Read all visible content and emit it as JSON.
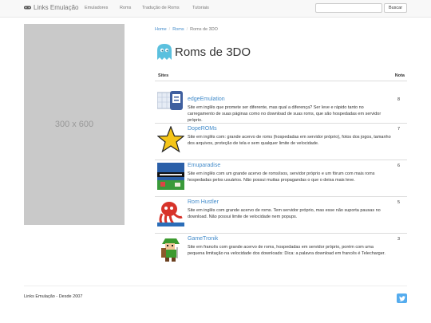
{
  "navbar": {
    "brand": "Links Emulação",
    "links": [
      "Emuladores",
      "Roms",
      "Tradução de Roms",
      "Tutoriais"
    ],
    "search_placeholder": "",
    "search_button": "Buscar"
  },
  "ad": {
    "label": "300 x 600"
  },
  "breadcrumb": {
    "home": "Home",
    "roms": "Roms",
    "current": "Roms de 3DO"
  },
  "page": {
    "title": "Roms de 3DO"
  },
  "table": {
    "headers": {
      "sites": "Sites",
      "score": "Nota"
    },
    "rows": [
      {
        "name": "edgeEmulation",
        "desc": "Site em inglês que promete ser diferente, mas qual a diferença? Ser leve e rápido tanto no carregamento de suas páginas como no download de suas roms, que são hospedadas em servidor próprio.",
        "score": "8",
        "icon": "robot-icon"
      },
      {
        "name": "DopeROMs",
        "desc": "Site em inglês com: grande acervo de roms (hospedadas em servidor próprio), fotos dos jogos, tamanho dos arquivos, proteção de tela e sem qualquer limite de velocidade.",
        "score": "7",
        "icon": "star-icon"
      },
      {
        "name": "Emuparadise",
        "desc": "Site em inglês com um grande acervo de roms/isos, servidor próprio e um fórum com mais roms hospedadas pelos usuários. Não possui muitas propagandas o que o deixa mais leve.",
        "score": "6",
        "icon": "emuparadise-icon"
      },
      {
        "name": "Rom Hustler",
        "desc": "Site em inglês com grande acervo de roms. Tem servidor próprio, mas esse não suporta pausas no download. Não possui limite de velocidade nem popups.",
        "score": "5",
        "icon": "octopus-icon"
      },
      {
        "name": "GameTronik",
        "desc": "Site em francês com grande acervo de roms, hospedadas em servidor próprio, porém com uma pequena limitação na velocidade dos downloads: Dica: a palavra download em francês é Telecharger.",
        "score": "3",
        "icon": "link-character-icon"
      }
    ]
  },
  "footer": {
    "text": "Links Emulação - Desde 2007"
  },
  "colors": {
    "accent": "#428bca",
    "twitter": "#55acee"
  }
}
